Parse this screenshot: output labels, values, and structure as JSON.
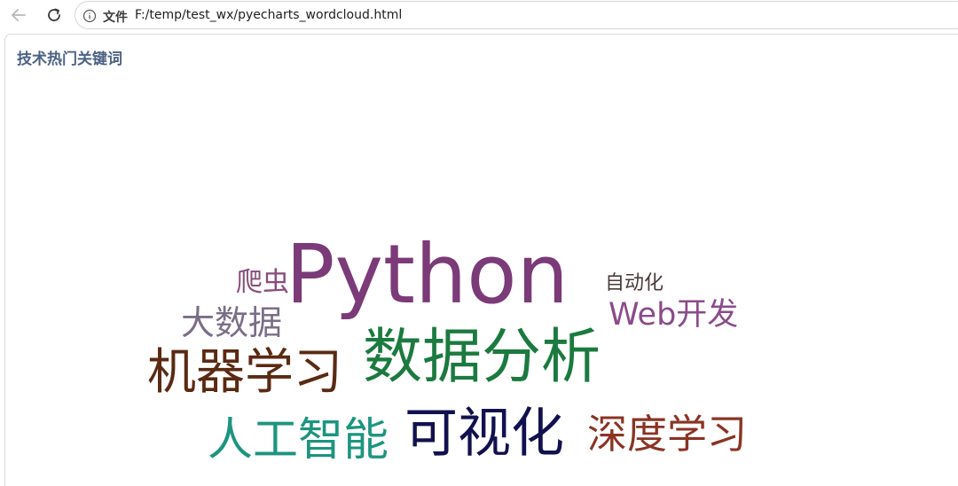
{
  "browser": {
    "back_icon": "arrow-left-icon",
    "reload_icon": "reload-icon",
    "info_icon": "info-circle-icon",
    "scheme_label": "文件",
    "url": "F:/temp/test_wx/pyecharts_wordcloud.html"
  },
  "chart_data": {
    "type": "wordcloud",
    "title": "技术热门关键词",
    "title_color": "#4c6284",
    "words": [
      {
        "name": "Python",
        "color": "#7b3a78"
      },
      {
        "name": "数据分析",
        "color": "#1b7a3f"
      },
      {
        "name": "可视化",
        "color": "#12114f"
      },
      {
        "name": "机器学习",
        "color": "#5a2a12"
      },
      {
        "name": "人工智能",
        "color": "#1d9480"
      },
      {
        "name": "深度学习",
        "color": "#8a3424"
      },
      {
        "name": "大数据",
        "color": "#7a6e87"
      },
      {
        "name": "Web开发",
        "color": "#8a4b8a"
      },
      {
        "name": "爬虫",
        "color": "#8a4b7a"
      },
      {
        "name": "自动化",
        "color": "#4a3a3a"
      }
    ]
  }
}
